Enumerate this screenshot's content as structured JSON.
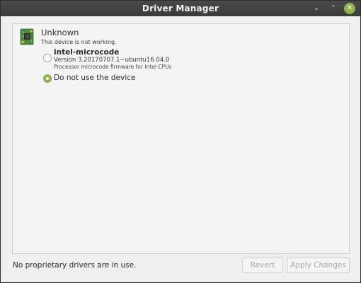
{
  "window": {
    "title": "Driver Manager",
    "minimize_glyph": "⌄",
    "maximize_glyph": "⌃",
    "close_glyph": "✕",
    "close_color": "#8fb44b"
  },
  "device": {
    "icon": "circuit-board-icon",
    "name": "Unknown",
    "status": "This device is not working.",
    "drivers": [
      {
        "name": "intel-microcode",
        "version": "Version 3.20170707.1~ubuntu16.04.0",
        "description": "Processor microcode firmware for Intel CPUs",
        "selected": false
      }
    ],
    "none_option": {
      "label": "Do not use the device",
      "selected": true
    }
  },
  "footer": {
    "status": "No proprietary drivers are in use.",
    "revert_label": "Revert",
    "apply_label": "Apply Changes",
    "buttons_enabled": false
  },
  "colors": {
    "accent": "#8fb44b",
    "titlebar": "#3c3c3c",
    "background": "#efefef"
  }
}
